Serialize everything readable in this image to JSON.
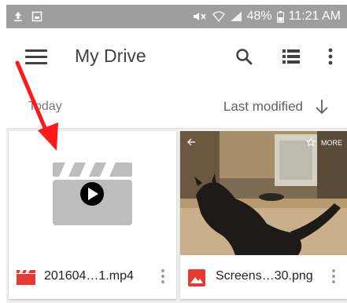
{
  "status_bar": {
    "battery": "48%",
    "time": "11:21 AM"
  },
  "app_bar": {
    "title": "My Drive",
    "icons": {
      "menu": "hamburger-menu-icon",
      "search": "search-icon",
      "view": "list-view-icon",
      "overflow": "more-vert-icon"
    }
  },
  "sort_row": {
    "section": "Today",
    "sort_by": "Last modified"
  },
  "files": [
    {
      "name": "201604…1.mp4",
      "type": "video",
      "icon_color": "#e53935"
    },
    {
      "name": "Screens…30.png",
      "type": "image",
      "icon_color": "#e53935"
    }
  ],
  "photo_overlay": {
    "more": "MORE"
  },
  "colors": {
    "status_bar": "#9e9e9e",
    "annotation_arrow": "#ff1a1a",
    "video_placeholder": "#bdbdbd"
  }
}
